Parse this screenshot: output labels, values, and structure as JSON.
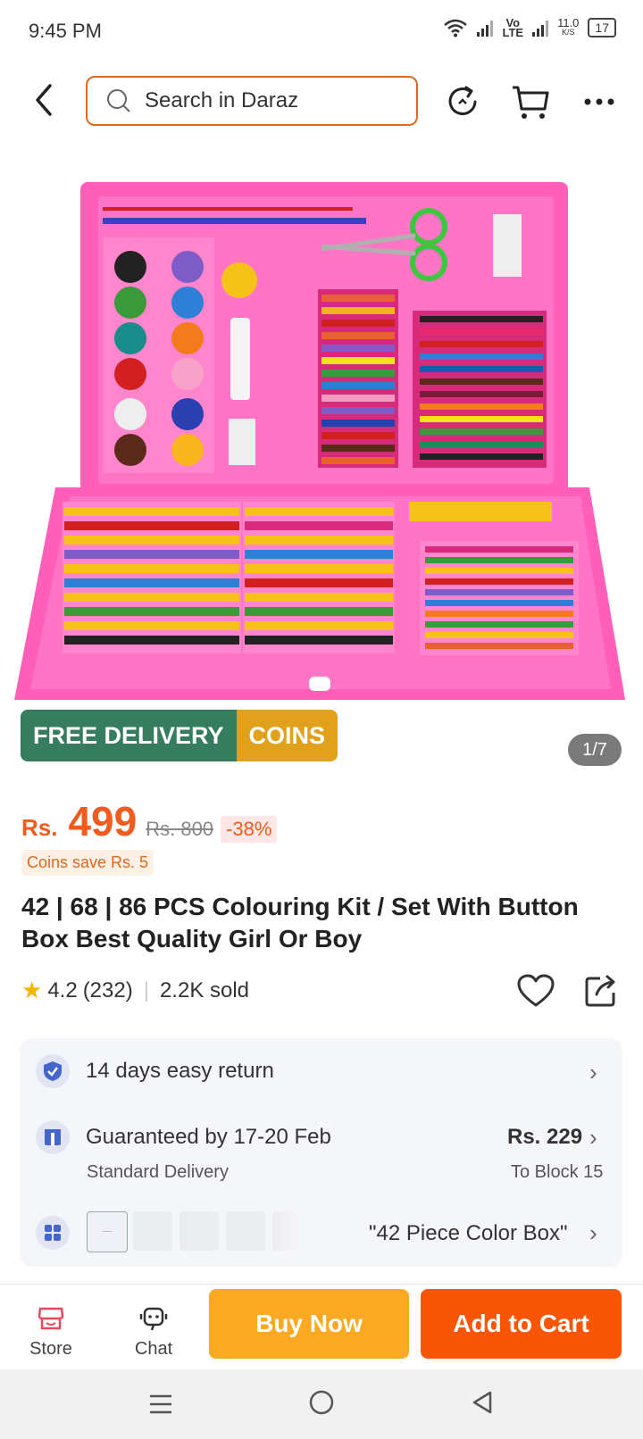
{
  "status_bar": {
    "time": "9:45 PM",
    "net_speed": "11.0",
    "net_unit": "K/S",
    "volte": "Vo",
    "lte": "LTE",
    "battery": "17"
  },
  "header": {
    "search_placeholder": "Search in Daraz"
  },
  "gallery": {
    "badge_delivery": "FREE DELIVERY",
    "badge_coins": "COINS",
    "counter": "1/7"
  },
  "price": {
    "currency": "Rs.",
    "current": "499",
    "original": "Rs. 800",
    "discount": "-38%",
    "coins_save": "Coins save Rs. 5"
  },
  "product": {
    "title": "42 | 68 | 86 PCS Colouring Kit / Set With Button Box Best Quality Girl Or Boy",
    "rating": "4.2",
    "reviews": "(232)",
    "sold": "2.2K sold"
  },
  "info": {
    "return_text": "14 days easy return",
    "delivery_text": "Guaranteed by 17-20 Feb",
    "delivery_sub": "Standard Delivery",
    "delivery_price": "Rs. 229",
    "delivery_to": "To Block 15",
    "variant": "\"42 Piece Color Box\"",
    "thumb_text": "—"
  },
  "bottom": {
    "store": "Store",
    "chat": "Chat",
    "buy_now": "Buy Now",
    "add_to_cart": "Add to Cart"
  },
  "colors": {
    "accent": "#f85606",
    "buy": "#fba923",
    "badge_green": "#367c5e",
    "badge_gold": "#e2a11b",
    "case_pink": "#ff5fb8"
  }
}
